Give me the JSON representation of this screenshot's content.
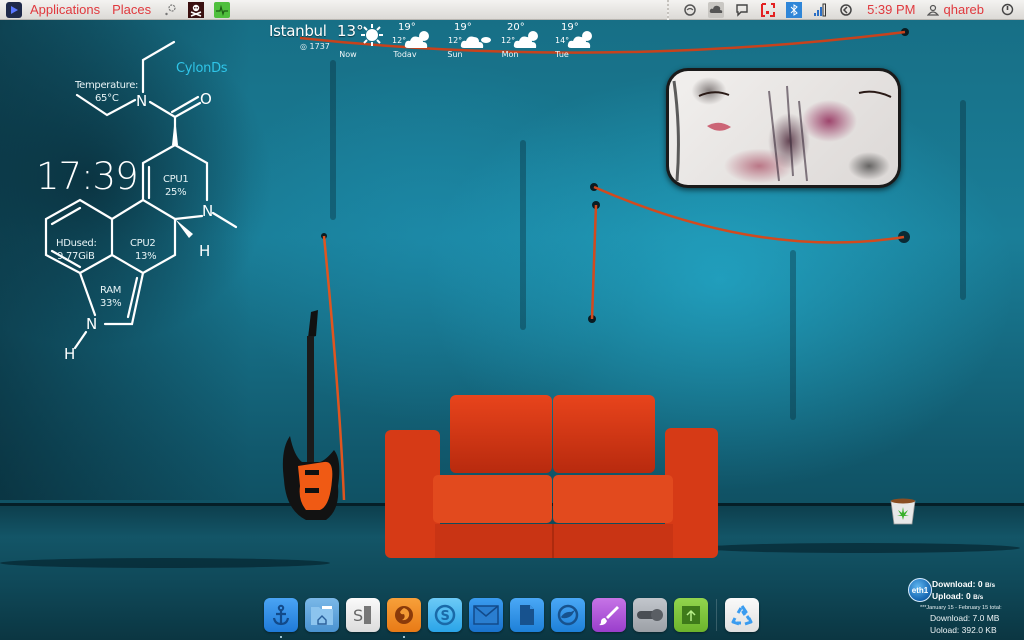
{
  "top_panel": {
    "launcher_icon": "launcher-icon",
    "menus": [
      {
        "label": "Applications"
      },
      {
        "label": "Places"
      }
    ],
    "left_tray": [
      {
        "icon": "settings-dots-icon"
      },
      {
        "icon": "skull-crossbones-icon"
      },
      {
        "icon": "system-monitor-icon"
      }
    ],
    "right_tray": [
      {
        "icon": "sync-icon"
      },
      {
        "icon": "cloud-icon"
      },
      {
        "icon": "chat-icon"
      },
      {
        "icon": "screenshot-icon"
      },
      {
        "icon": "bluetooth-icon"
      },
      {
        "icon": "network-signal-icon"
      },
      {
        "icon": "update-icon"
      }
    ],
    "clock": "5:39 PM",
    "user": "qhareb",
    "power_icon": "power-icon",
    "accent_color": "#e0393e"
  },
  "weather": {
    "city": "Istanbul",
    "current_temp": "13°",
    "station": "1737",
    "forecast": [
      {
        "day": "Now",
        "icon": "sun-icon"
      },
      {
        "day": "Todav",
        "high": "19°",
        "low": "12°",
        "icon": "partly-cloudy-icon"
      },
      {
        "day": "Sun",
        "high": "19°",
        "low": "12°",
        "icon": "cloudy-icon"
      },
      {
        "day": "Mon",
        "high": "20°",
        "low": "12°",
        "icon": "partly-cloudy-icon"
      },
      {
        "day": "Tue",
        "high": "19°",
        "low": "14°",
        "icon": "partly-cloudy-icon"
      }
    ]
  },
  "conky": {
    "brand": "CylonDs",
    "clock": "17:39",
    "temperature_label": "Temperature:",
    "temperature_value": "65°C",
    "cpu1_label": "CPU1",
    "cpu1_value": "25%",
    "cpu2_label": "CPU2",
    "cpu2_value": "13%",
    "hd_label": "HDused:",
    "hd_value": "9.77GiB",
    "ram_label": "RAM",
    "ram_value": "33%",
    "atoms": {
      "n": "N",
      "o": "O",
      "h": "H"
    },
    "accent_color": "#2fc5e8"
  },
  "network": {
    "interface": "eth1",
    "download_label": "Download:",
    "download_value": "0",
    "download_unit": "B/s",
    "upload_label": "Upload:",
    "upload_value": "0",
    "upload_unit": "B/s",
    "period": "***January 15 - February 15 total:",
    "total_download": "Download: 7.0 MB",
    "total_upload": "Uoload: 392.0 KB"
  },
  "dock": {
    "items": [
      {
        "name": "anchor",
        "icon": "anchor-icon",
        "color": "#2f8fe8",
        "running": true
      },
      {
        "name": "home-folder",
        "icon": "home-folder-icon",
        "color": "#5aa7e0",
        "running": false
      },
      {
        "name": "text-editor",
        "icon": "text-editor-icon",
        "color": "#e8e8e6",
        "running": false
      },
      {
        "name": "firefox",
        "icon": "firefox-icon",
        "color": "#f08a22",
        "running": true
      },
      {
        "name": "skype",
        "icon": "skype-icon",
        "color": "#3fb0ee",
        "running": false
      },
      {
        "name": "mail",
        "icon": "mail-icon",
        "color": "#2a8be0",
        "running": false
      },
      {
        "name": "document",
        "icon": "document-icon",
        "color": "#2f92ea",
        "running": false
      },
      {
        "name": "browser",
        "icon": "browser-icon",
        "color": "#2f92ea",
        "running": false
      },
      {
        "name": "paint",
        "icon": "paintbrush-icon",
        "color": "#b058d8",
        "running": false
      },
      {
        "name": "toggle-settings",
        "icon": "toggle-icon",
        "color": "#a8acb2",
        "running": false
      },
      {
        "name": "uploader",
        "icon": "upload-icon",
        "color": "#7bc23c",
        "running": false
      },
      {
        "name": "trash",
        "icon": "recycle-icon",
        "color": "#eeeeee",
        "running": false
      }
    ]
  }
}
